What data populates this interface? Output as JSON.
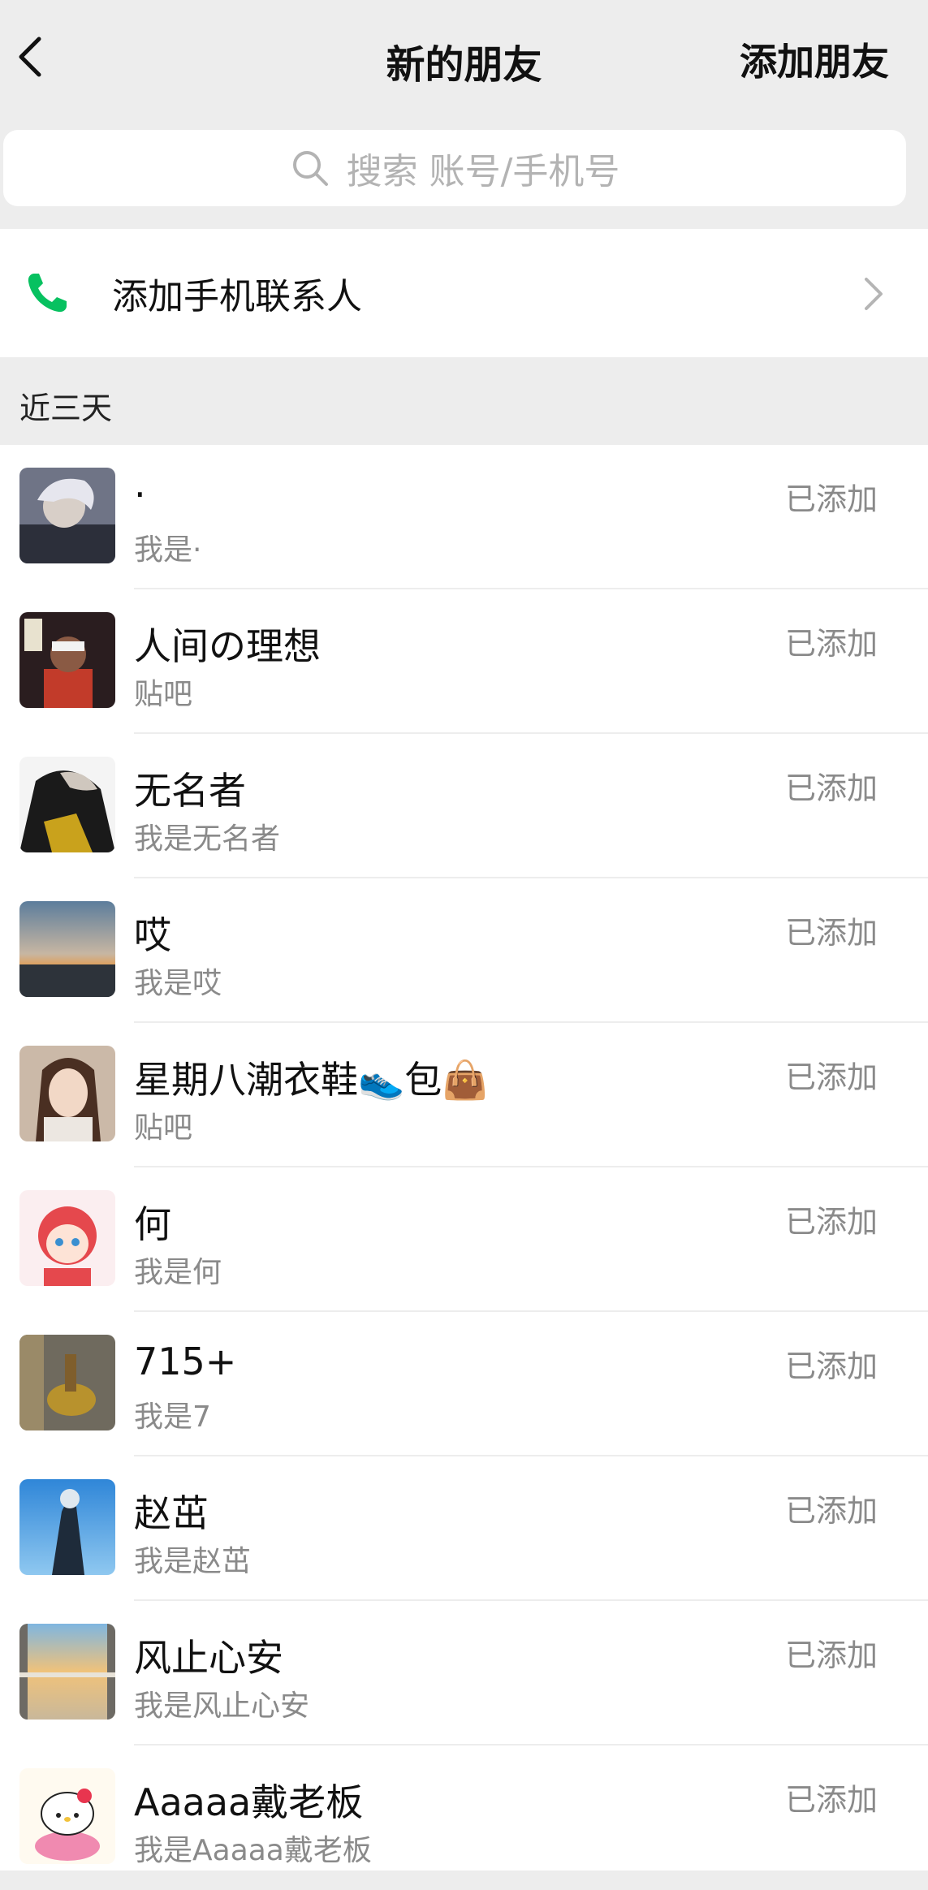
{
  "header": {
    "title": "新的朋友",
    "action_label": "添加朋友"
  },
  "search": {
    "placeholder": "搜索 账号/手机号"
  },
  "phone_contacts": {
    "label": "添加手机联系人",
    "icon_color": "#07c160"
  },
  "section": {
    "title": "近三天"
  },
  "requests": [
    {
      "name": "·",
      "message": "我是·",
      "status": "已添加"
    },
    {
      "name": "人间の理想",
      "message": "贴吧",
      "status": "已添加"
    },
    {
      "name": "无名者",
      "message": "我是无名者",
      "status": "已添加"
    },
    {
      "name": "哎",
      "message": "我是哎",
      "status": "已添加"
    },
    {
      "name": "星期八潮衣鞋👟包👜",
      "message": "贴吧",
      "status": "已添加"
    },
    {
      "name": "何",
      "message": "我是何",
      "status": "已添加"
    },
    {
      "name": "715+",
      "message": "我是7",
      "status": "已添加"
    },
    {
      "name": "赵茁",
      "message": "我是赵茁",
      "status": "已添加"
    },
    {
      "name": "风止心安",
      "message": "我是风止心安",
      "status": "已添加"
    },
    {
      "name": "Aaaaa戴老板",
      "message": "我是Aaaaa戴老板",
      "status": "已添加"
    }
  ]
}
